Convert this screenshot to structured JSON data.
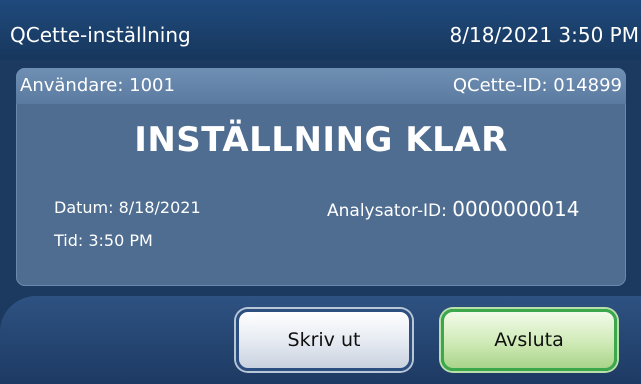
{
  "header": {
    "title": "QCette-inställning",
    "datetime": "8/18/2021 3:50 PM"
  },
  "panel": {
    "user": "Användare: 1001",
    "qcette_id": "QCette-ID: 014899",
    "heading": "INSTÄLLNING KLAR",
    "date": "Datum: 8/18/2021",
    "time": "Tid: 3:50 PM",
    "analyzer_label": "Analysator-ID:",
    "analyzer_value": "0000000014"
  },
  "buttons": {
    "print": "Skriv ut",
    "exit": "Avsluta"
  },
  "colors": {
    "header_bg": "#1f4a7c",
    "panel_bg": "#4e6d91",
    "panel_header_bg": "#6f8fb3",
    "print_border": "#2d4f80",
    "exit_border": "#3aa84b"
  }
}
